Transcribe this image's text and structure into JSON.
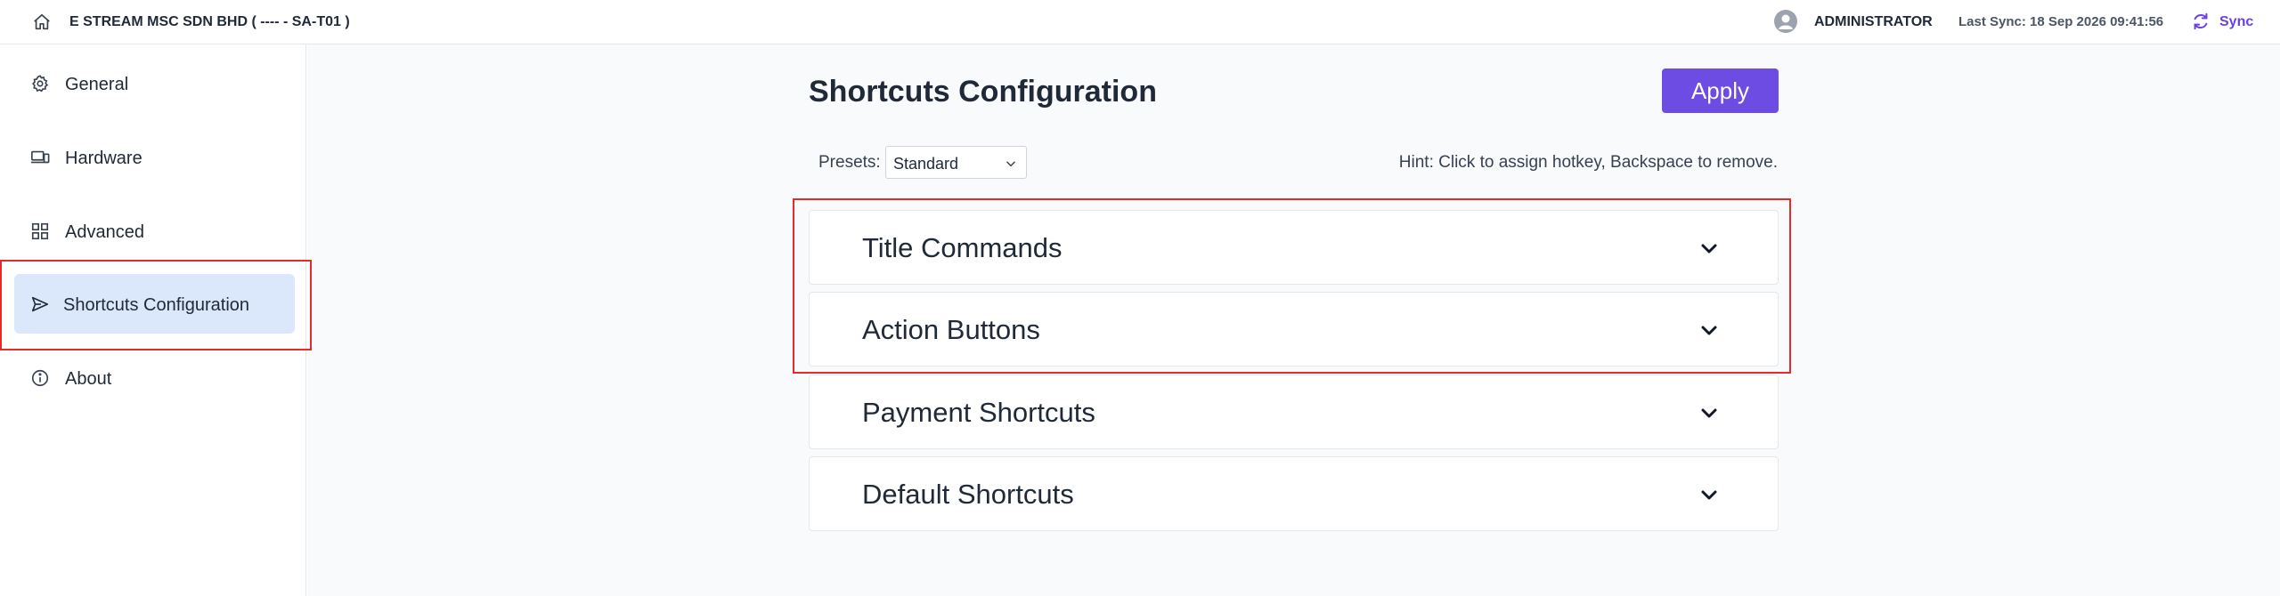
{
  "header": {
    "company": "E STREAM MSC SDN BHD ( ---- - SA-T01 )",
    "user": "ADMINISTRATOR",
    "last_sync": "Last Sync: 18 Sep 2026 09:41:56",
    "sync_label": "Sync",
    "icons": {
      "home": "home-icon",
      "avatar": "user-avatar-icon",
      "sync": "sync-icon"
    }
  },
  "sidebar": {
    "items": [
      {
        "label": "General",
        "icon": "gear-icon"
      },
      {
        "label": "Hardware",
        "icon": "devices-icon"
      },
      {
        "label": "Advanced",
        "icon": "grid-icon"
      },
      {
        "label": "Shortcuts Configuration",
        "icon": "send-icon",
        "active": true
      },
      {
        "label": "About",
        "icon": "info-icon"
      }
    ]
  },
  "main": {
    "title": "Shortcuts Configuration",
    "apply_label": "Apply",
    "presets_label": "Presets:",
    "presets_value": "Standard",
    "hint": "Hint: Click to assign hotkey, Backspace to remove.",
    "sections": [
      {
        "title": "Title Commands"
      },
      {
        "title": "Action Buttons"
      },
      {
        "title": "Payment Shortcuts"
      },
      {
        "title": "Default Shortcuts"
      }
    ]
  },
  "colors": {
    "accent": "#6d4ce3",
    "active_item_bg": "#dbe7fb",
    "highlight_border": "#e32b2b",
    "sync_text": "#6d3ee6"
  }
}
